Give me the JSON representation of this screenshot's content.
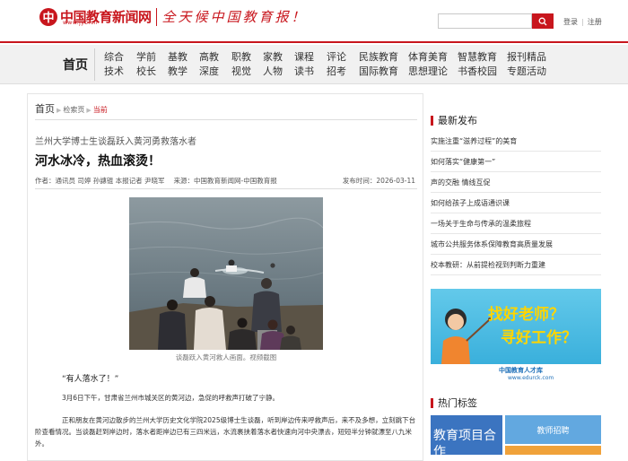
{
  "header": {
    "logo_mark": "中",
    "logo_text": "中国教育新闻网",
    "logo_url": "www.jyb.cn",
    "slogan": "全天候中国教育报！",
    "search_placeholder": "",
    "login": "登录",
    "register": "注册"
  },
  "nav": {
    "home": "首页",
    "columns": [
      [
        "综合",
        "技术"
      ],
      [
        "学前",
        "校长"
      ],
      [
        "基教",
        "教学"
      ],
      [
        "高教",
        "深度"
      ],
      [
        "职教",
        "视觉"
      ],
      [
        "家教",
        "人物"
      ],
      [
        "课程",
        "读书"
      ],
      [
        "评论",
        "招考"
      ],
      [
        "民族教育",
        "国际教育"
      ],
      [
        "体育美育",
        "思想理论"
      ],
      [
        "智慧教育",
        "书香校园"
      ],
      [
        "报刊精品",
        "专题活动"
      ]
    ]
  },
  "breadcrumb": {
    "home": "首页",
    "section": "检索页",
    "current": "当前"
  },
  "article": {
    "subtitle": "兰州大学博士生谈磊跃入黄河勇救落水者",
    "title": "河水冰冷，热血滚烫！",
    "authors": "作者：通讯员 司婷 孙譓锟 本报记者 尹晓军",
    "source": "来源：中国教育新闻网-中国教育报",
    "pubtime": "发布时间：2026-03-11",
    "photo_caption": "谈磊跃入黄河救人画面。视频截图",
    "quote": "“有人落水了！”",
    "para1": "3月6日下午，甘肃省兰州市城关区的黄河边，急促的呼救声打破了宁静。",
    "para2": "正和朋友在黄河边散步的兰州大学历史文化学院2025级博士生谈磊，听到岸边传来呼救声后，来不及多想，立刻跳下台阶查看情况。当谈磊赶到岸边时，落水者距岸边已有三四米远，水流裹挟着落水者快速向河中央漂去，短短半分钟就漂至八九米外。"
  },
  "sidebar": {
    "latest_title": "最新发布",
    "latest": [
      "实施注重“滋养过程”的美育",
      "如何落实“健康第一”",
      "声的交融 情线互促",
      "如何给孩子上成语通识课",
      "一场关于生命与传承的温柔旅程",
      "城市公共服务体系保障教育高质量发展",
      "校本教研：从前提检视到判断力重建"
    ],
    "ad": {
      "q1": "找好老师？",
      "q2": "寻好工作？",
      "brand": "中国教育人才库",
      "url": "www.edurck.com"
    },
    "tags_title": "热门标签",
    "tag_a": "教育项目合作",
    "tag_b": "教师招聘"
  },
  "colors": {
    "brand_red": "#c8161d",
    "nav_bg": "#f1f1f1",
    "ad_blue": "#2fa9d8"
  }
}
